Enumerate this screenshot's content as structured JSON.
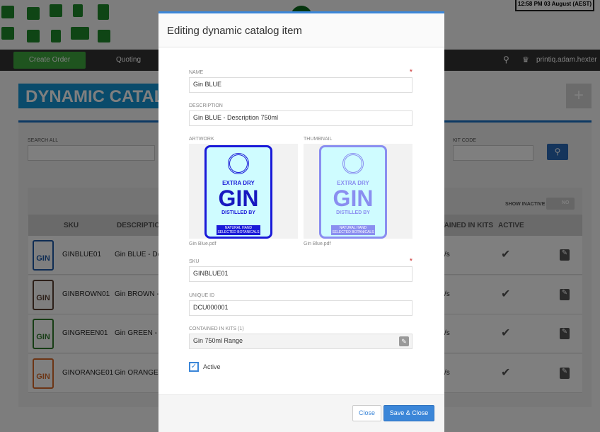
{
  "header": {
    "clock": "12:58 PM 03 August (AEST)"
  },
  "nav": {
    "create_order": "Create Order",
    "quoting": "Quoting",
    "user": "printiq.adam.hexter"
  },
  "page": {
    "title": "DYNAMIC CATALOG",
    "add_icon": "plus-icon",
    "search_all_label": "SEARCH ALL",
    "kit_code_label": "KIT CODE",
    "show_inactive_label": "SHOW INACTIVE",
    "show_inactive_value": "NO",
    "accent": "#1596d6"
  },
  "table": {
    "headers": [
      "SKU",
      "DESCRIPTION",
      "CONTAINED IN KITS",
      "ACTIVE"
    ],
    "rows": [
      {
        "sku": "GINBLUE01",
        "description": "Gin BLUE - Des",
        "kits": "/s",
        "color": "#1e5aa8"
      },
      {
        "sku": "GINBROWN01",
        "description": "Gin BROWN - D",
        "kits": "/s",
        "color": "#5a4032"
      },
      {
        "sku": "GINGREEN01",
        "description": "Gin GREEN - D",
        "kits": "/s",
        "color": "#2f7a2a"
      },
      {
        "sku": "GINORANGE01",
        "description": "Gin ORANGE -",
        "kits": "/s",
        "color": "#d86a2a"
      }
    ]
  },
  "modal": {
    "title": "Editing dynamic catalog item",
    "name_label": "NAME",
    "name": "Gin BLUE",
    "description_label": "DESCRIPTION",
    "description": "Gin BLUE - Description 750ml",
    "artwork_label": "ARTWORK",
    "artwork_file": "Gin Blue.pdf",
    "thumbnail_label": "THUMBNAIL",
    "thumbnail_file": "Gin Blue.pdf",
    "label_art": {
      "top": "EXTRA DRY",
      "main": "GIN",
      "sub": "DISTILLED BY",
      "bottom": "NATURAL HAND SELECTED BOTANICALS"
    },
    "sku_label": "SKU",
    "sku": "GINBLUE01",
    "unique_id_label": "UNIQUE ID",
    "unique_id": "DCU000001",
    "kits_label": "CONTAINED IN KITS (1)",
    "kits": "Gin 750ml Range",
    "active_label": "Active",
    "active": true,
    "close": "Close",
    "save_close": "Save & Close"
  }
}
